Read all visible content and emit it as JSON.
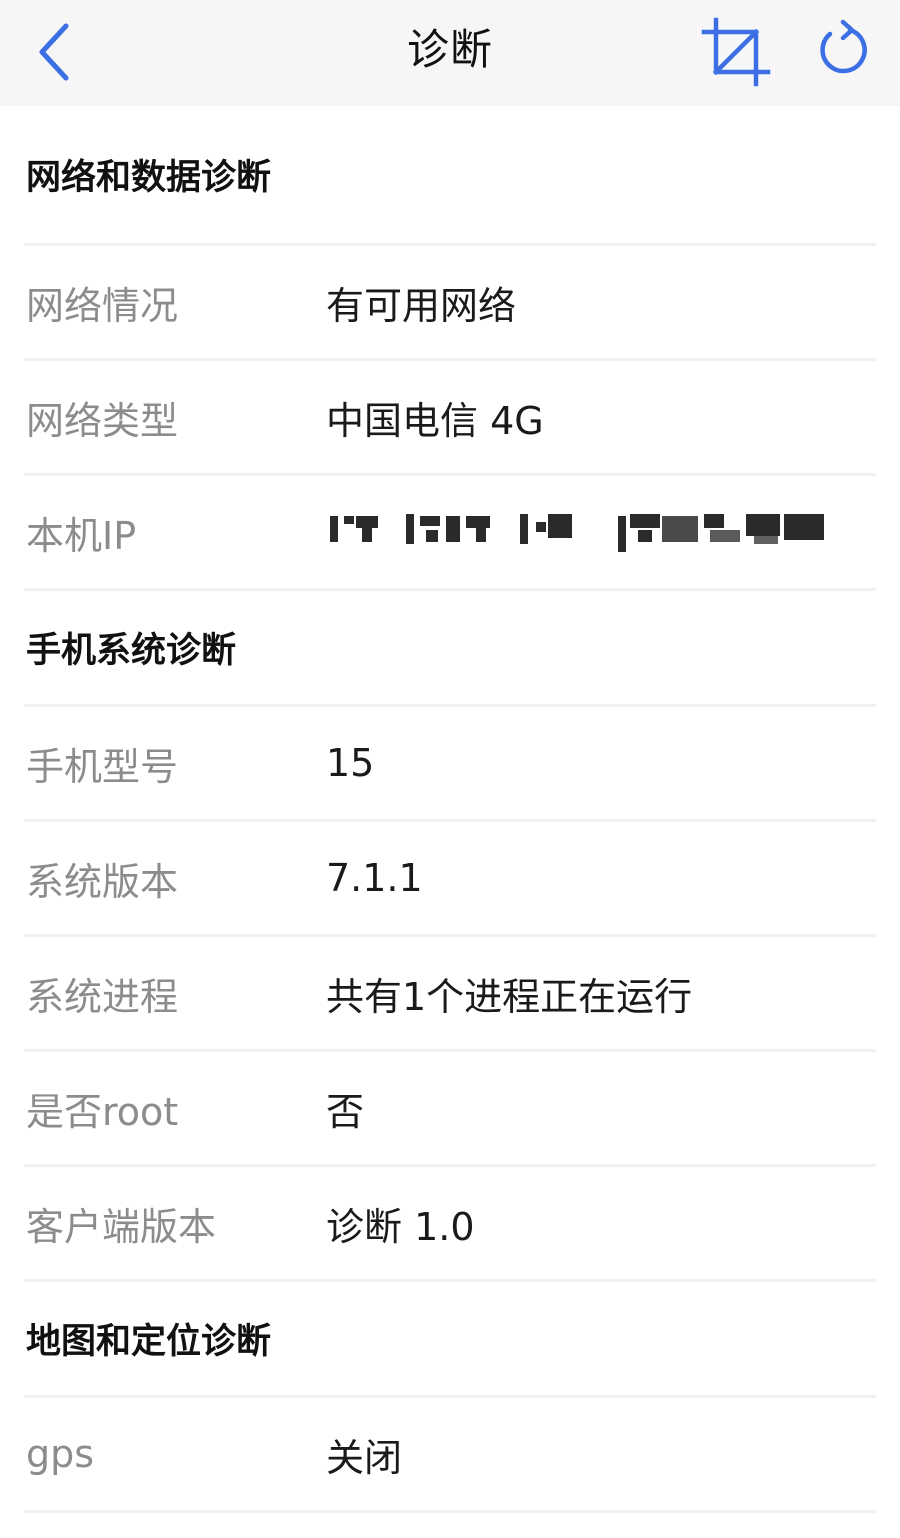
{
  "header": {
    "title": "诊断",
    "back_icon": "chevron-left-icon",
    "crop_icon": "crop-icon",
    "refresh_icon": "refresh-icon",
    "icon_color": "#3b6fe3"
  },
  "sections": [
    {
      "title": "网络和数据诊断",
      "rows": [
        {
          "label": "网络情况",
          "value": "有可用网络"
        },
        {
          "label": "网络类型",
          "value": "中国电信 4G"
        },
        {
          "label": "本机IP",
          "value": ""
        }
      ]
    },
    {
      "title": "手机系统诊断",
      "rows": [
        {
          "label": "手机型号",
          "value": "15"
        },
        {
          "label": "系统版本",
          "value": "7.1.1"
        },
        {
          "label": "系统进程",
          "value": "共有1个进程正在运行"
        },
        {
          "label": "是否root",
          "value": "否"
        },
        {
          "label": "客户端版本",
          "value": "诊断 1.0"
        }
      ]
    },
    {
      "title": "地图和定位诊断",
      "rows": [
        {
          "label": "gps",
          "value": "关闭"
        }
      ]
    }
  ]
}
